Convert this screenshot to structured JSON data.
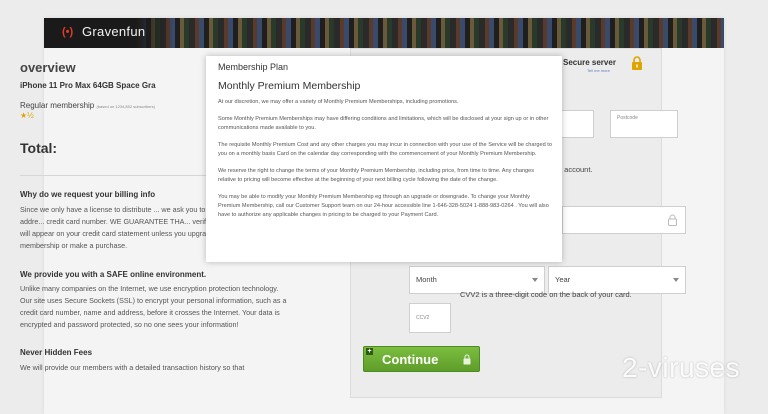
{
  "header": {
    "logo_mark": "(•)",
    "site_name": "Gravenfun"
  },
  "order": {
    "title": "overview",
    "product": "iPhone 11 Pro Max 64GB Space Gra",
    "membership_label": "Regular membership",
    "membership_note": "(based on 1234,852 subscribers)",
    "stars": "★½",
    "total_label": "Total:"
  },
  "info": {
    "why_heading": "Why do we request your billing info",
    "why_text": "Since we only have a license to distribute ... we ask you to confirm your mailing addre... credit card number. WE GUARANTEE THA... verify your account. No fees will appear on your credit card statement unless you upgrade to a premium membership or make a purchase.",
    "safe_heading": "We provide you with a SAFE online environment.",
    "safe_text": "Unlike many companies on the Internet, we use encryption protection technology. Our site uses Secure Sockets (SSL) to encrypt your personal information, such as a credit card number, name and address, before it crosses the Internet. Your data is encrypted and password protected, so no one sees your information!",
    "fees_heading": "Never Hidden Fees",
    "fees_text": "We will provide our members with a detailed transaction history so that"
  },
  "payment": {
    "secure_title": "Secure server",
    "secure_link": "Tell me more",
    "postcode_placeholder": "Postcode",
    "verify_text": "for verifying your account.",
    "month_value": "Month",
    "year_value": "Year",
    "cvv_placeholder": "CCV2",
    "cvv_note": "CVV2 is a three-digit code on the back of your card.",
    "continue_label": "Continue",
    "continue_plus": "+"
  },
  "modal": {
    "title": "Membership Plan",
    "subtitle": "Monthly Premium Membership",
    "p1": "At our discretion, we may offer a variety of Monthly Premium Memberships, including promotions.",
    "p2": "Some Monthly Premium Memberships may have differing conditions and limitations, which will be disclosed at your sign up or in other communications made available to you.",
    "p3": "The requisite Monthly Premium Cost and any other charges you may incur in connection with your use of the Service will be charged to you on a monthly basis Card on the calendar day corresponding with the commencement of your Monthly Premium Membership.",
    "p4": "We reserve the right to change the terms of your Monthly Premium Membership, including price, from time to time. Any changes relative to pricing will become effective at the beginning of your next billing cycle following the date of the change.",
    "p5": "You may be able to modify your Monthly Premium Membership eg through an upgrade or downgrade. To change your Monthly Premium Membership, call our Customer Support team on our 24-hour accessible line 1-646-328-5024 1-888-983-0264 . You will also have to authorize any applicable changes in pricing to be charged to your Payment Card."
  },
  "watermark": "2-viruses",
  "colors": {
    "accent_green": "#6aaa34",
    "lock_gold": "#e0a400",
    "logo_red": "#e23b2a"
  }
}
